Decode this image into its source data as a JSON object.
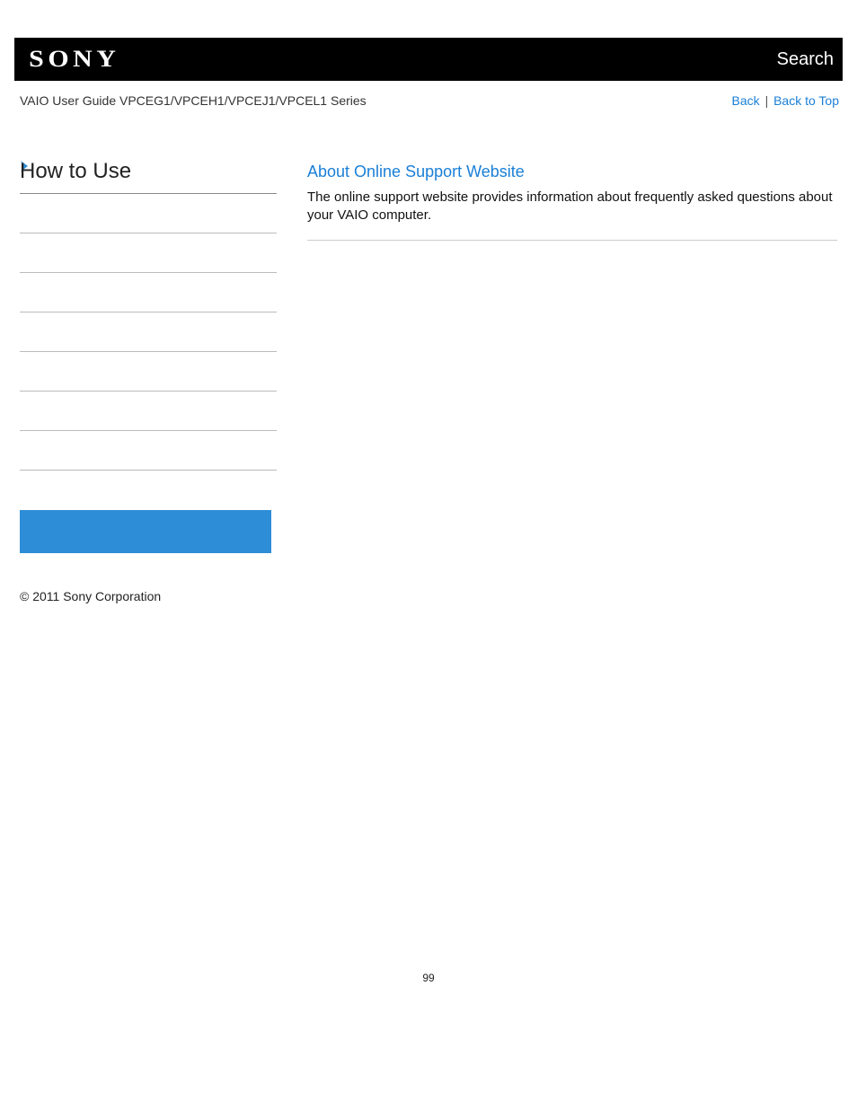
{
  "header": {
    "logo_text": "SONY",
    "search_label": "Search"
  },
  "subheader": {
    "breadcrumb": "VAIO User Guide VPCEG1/VPCEH1/VPCEJ1/VPCEL1 Series",
    "back_label": "Back",
    "back_to_top_label": "Back to Top",
    "separator": " | "
  },
  "sidebar": {
    "title": "How to Use"
  },
  "main": {
    "heading": "About Online Support Website",
    "body": "The online support website provides information about frequently asked questions about your VAIO computer."
  },
  "footer": {
    "copyright": "© 2011 Sony Corporation"
  },
  "page_number": "99"
}
